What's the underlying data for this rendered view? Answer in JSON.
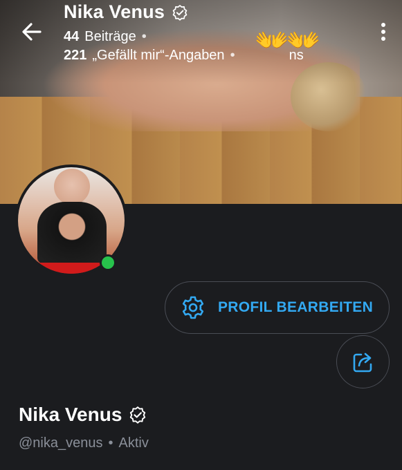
{
  "header": {
    "name": "Nika Venus",
    "posts_count": "44",
    "posts_label": "Beiträge",
    "likes_count": "221",
    "likes_label": "„Gefällt mir“-Angaben",
    "trailing_fragment": "ns",
    "emoji": "👐"
  },
  "actions": {
    "edit_profile_label": "PROFIL BEARBEITEN"
  },
  "profile": {
    "name": "Nika Venus",
    "handle": "@nika_venus",
    "status": "Aktiv"
  },
  "colors": {
    "accent": "#33a9f2",
    "online": "#27c24c",
    "background": "#1b1c1f"
  }
}
